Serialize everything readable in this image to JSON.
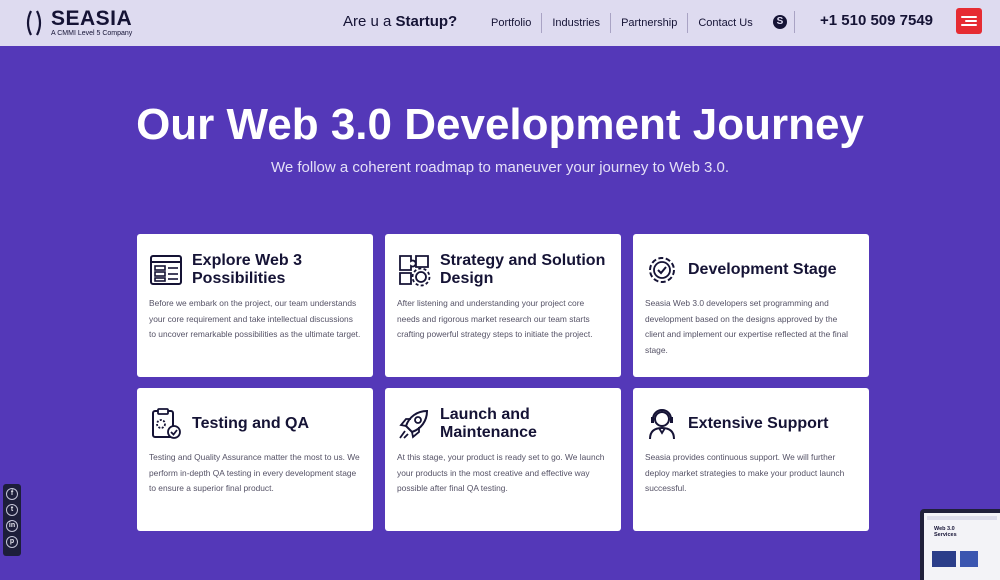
{
  "brand": {
    "name": "SEASIA",
    "tagline": "A CMMI Level 5 Company"
  },
  "header": {
    "startup_prefix": "Are u a",
    "startup_emphasis": "Startup?",
    "nav": [
      "Portfolio",
      "Industries",
      "Partnership",
      "Contact Us"
    ],
    "phone": "+1 510 509 7549",
    "skype_icon": "skype-icon",
    "menu_icon": "hamburger-menu-icon"
  },
  "hero": {
    "title": "Our Web 3.0 Development Journey",
    "subtitle": "We follow a coherent roadmap to maneuver your journey to Web 3.0."
  },
  "cards": [
    {
      "title": "Explore Web 3 Possibilities",
      "icon": "web-layout-icon",
      "text": "Before we embark on the project, our team understands your core requirement and take intellectual discussions to uncover remarkable possibilities as the ultimate target."
    },
    {
      "title": "Strategy and Solution Design",
      "icon": "puzzle-gear-icon",
      "text": "After listening and understanding your project core needs and rigorous market research our team starts crafting powerful strategy steps to initiate the project."
    },
    {
      "title": "Development Stage",
      "icon": "gear-check-icon",
      "text": "Seasia Web 3.0 developers set programming and development based on the designs approved by the client and implement our expertise reflected at the final stage."
    },
    {
      "title": "Testing and QA",
      "icon": "clipboard-check-icon",
      "text": "Testing and Quality Assurance matter the most to us. We perform in-depth QA testing in every development stage to ensure a superior final product."
    },
    {
      "title": "Launch and Maintenance",
      "icon": "rocket-icon",
      "text": "At this stage, your product is ready set to go. We launch your products in the most creative and effective way possible after final QA testing."
    },
    {
      "title": "Extensive Support",
      "icon": "headset-support-icon",
      "text": "Seasia provides continuous support. We will further deploy market strategies to make your product launch successful."
    }
  ],
  "social": [
    "f",
    "t",
    "in",
    "p"
  ],
  "preview": {
    "title": "Web 3.0 Services"
  },
  "colors": {
    "background": "#5438b8",
    "header": "#dedbf0",
    "accent": "#e62b32",
    "text_dark": "#151335"
  }
}
